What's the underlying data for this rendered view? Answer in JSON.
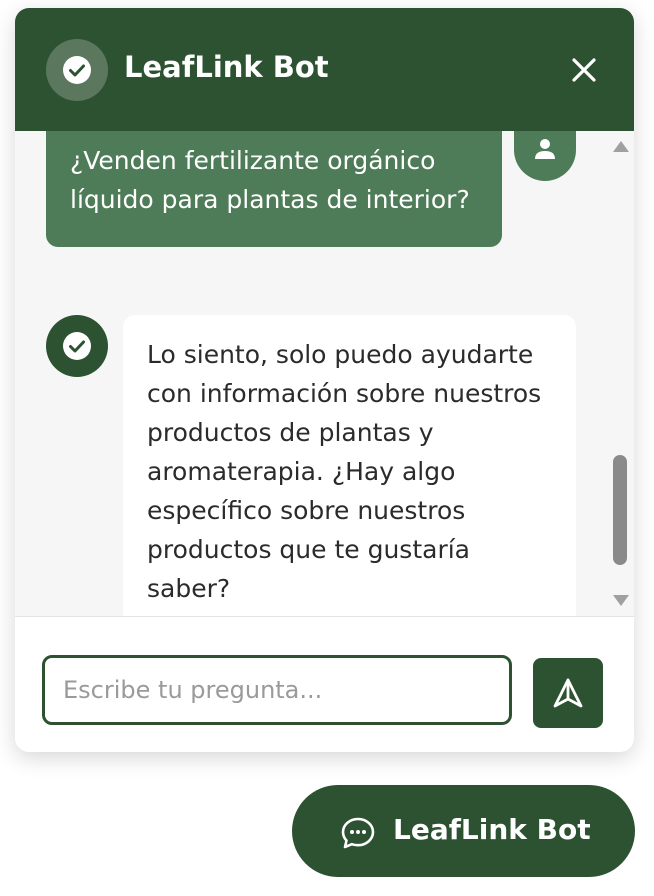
{
  "header": {
    "title": "LeafLink Bot"
  },
  "messages": [
    {
      "role": "user",
      "text": "¿Venden fertilizante orgánico líquido para plantas de interior?"
    },
    {
      "role": "bot",
      "text": "Lo siento, solo puedo ayudarte con información sobre nuestros productos de plantas y aromaterapia. ¿Hay algo específico sobre nuestros productos que te gustaría saber?"
    }
  ],
  "input": {
    "placeholder": "Escribe tu pregunta...",
    "value": ""
  },
  "launcher": {
    "label": "LeafLink Bot"
  },
  "icons": {
    "header_avatar": "check-circle-icon",
    "close": "close-icon",
    "user_avatar": "user-icon",
    "bot_avatar": "check-circle-icon",
    "send": "send-icon",
    "launcher": "chat-bubble-icon"
  },
  "colors": {
    "primary": "#2d5232",
    "user_bubble": "#4e7c58",
    "bot_bubble": "#ffffff",
    "messages_background": "#f6f6f6"
  }
}
